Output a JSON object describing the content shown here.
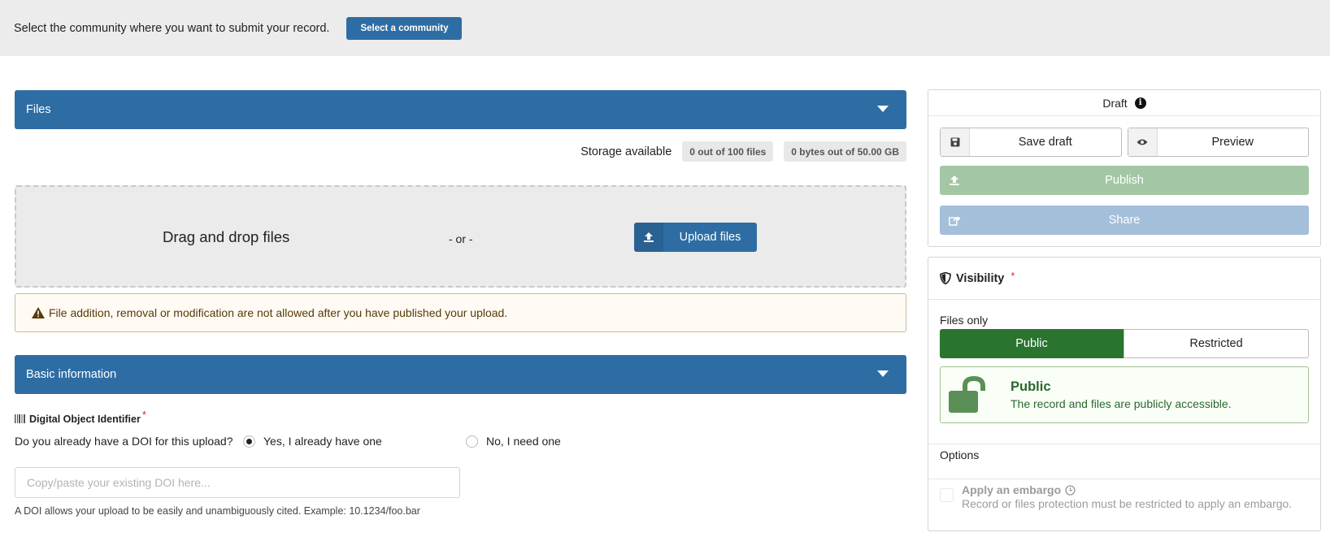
{
  "topbar": {
    "message": "Select the community where you want to submit your record.",
    "select_community_label": "Select a community"
  },
  "files_section": {
    "title": "Files",
    "storage_label": "Storage available",
    "files_count": "0 out of 100 files",
    "bytes_count": "0 bytes out of 50.00 GB",
    "drag_drop_text": "Drag and drop files",
    "or_text": "- or -",
    "upload_label": "Upload files",
    "warning_text": "File addition, removal or modification are not allowed after you have published your upload."
  },
  "basic_info": {
    "title": "Basic information",
    "doi_title": "Digital Object Identifier",
    "required_mark": "*",
    "doi_question": "Do you already have a DOI for this upload?",
    "option_yes": "Yes, I already have one",
    "option_no": "No, I need one",
    "selected_option": "yes",
    "doi_placeholder": "Copy/paste your existing DOI here...",
    "doi_value": "",
    "doi_help": "A DOI allows your upload to be easily and unambiguously cited. Example: 10.1234/foo.bar"
  },
  "sidebar": {
    "draft_label": "Draft",
    "save_draft_label": "Save draft",
    "preview_label": "Preview",
    "publish_label": "Publish",
    "share_label": "Share",
    "visibility_title": "Visibility",
    "required_mark": "*",
    "files_only_label": "Files only",
    "public_label": "Public",
    "restricted_label": "Restricted",
    "selected_visibility": "public",
    "public_box_title": "Public",
    "public_box_desc": "The record and files are publicly accessible.",
    "options_label": "Options",
    "embargo_title": "Apply an embargo",
    "embargo_desc": "Record or files protection must be restricted to apply an embargo."
  },
  "colors": {
    "primary": "#2e6da4",
    "public_green": "#2a7430",
    "publish_disabled": "#a3c7a4",
    "share_disabled": "#a3bfd9",
    "warning_text": "#573a08"
  }
}
